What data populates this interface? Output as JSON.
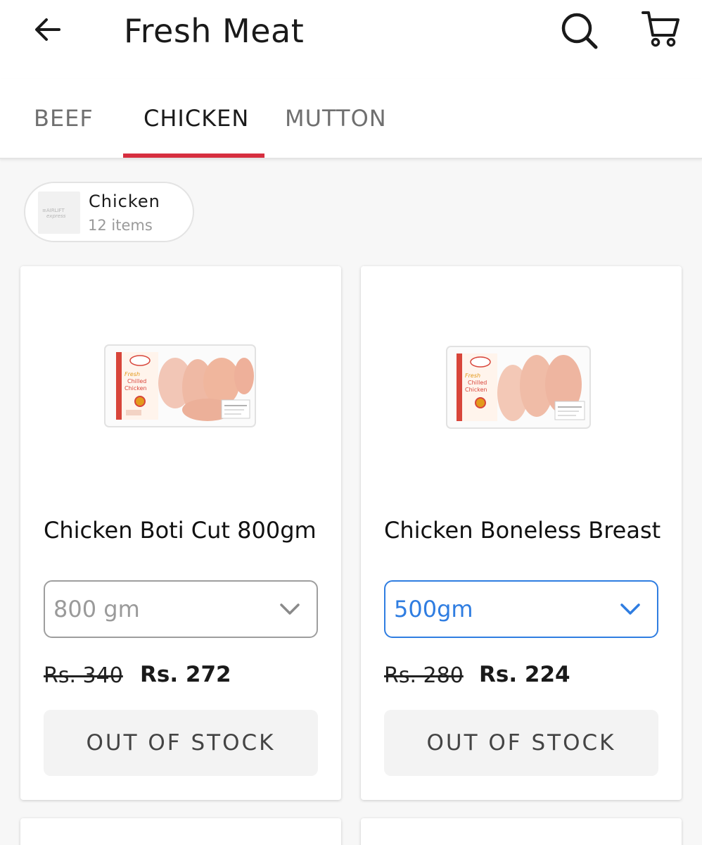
{
  "header": {
    "title": "Fresh Meat",
    "icons": {
      "back": "arrow-left-icon",
      "search": "search-icon",
      "cart": "cart-icon"
    }
  },
  "tabs": [
    {
      "label": "BEEF",
      "active": false
    },
    {
      "label": "CHICKEN",
      "active": true
    },
    {
      "label": "MUTTON",
      "active": false
    }
  ],
  "category_chip": {
    "title": "Chicken",
    "subtitle": "12 items",
    "logo_text": "AIRLIFT express"
  },
  "products": [
    {
      "name": "Chicken Boti Cut 800gm",
      "variant": "800 gm",
      "old_price": "Rs. 340",
      "price": "Rs. 272",
      "button": "OUT OF STOCK",
      "package_label": "Fresh Chilled Chicken"
    },
    {
      "name": "Chicken Boneless Breast",
      "variant": "500gm",
      "old_price": "Rs. 280",
      "price": "Rs. 224",
      "button": "OUT OF STOCK",
      "package_label": "Fresh Chilled Chicken"
    }
  ],
  "colors": {
    "accent_red": "#d62e3f",
    "select_blue": "#2f7de1",
    "background": "#f7f7f7"
  }
}
